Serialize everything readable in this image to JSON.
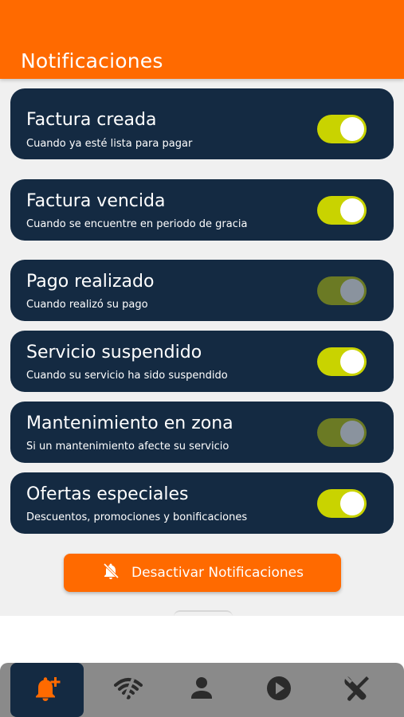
{
  "header": {
    "title": "Notificaciones"
  },
  "notifications": [
    {
      "title": "Factura creada",
      "subtitle": "Cuando ya esté lista para pagar",
      "enabled": true
    },
    {
      "title": "Factura vencida",
      "subtitle": "Cuando se encuentre en periodo de gracia",
      "enabled": true
    },
    {
      "title": "Pago realizado",
      "subtitle": "Cuando realizó su pago",
      "enabled": false
    },
    {
      "title": "Servicio suspendido",
      "subtitle": "Cuando su servicio ha sido suspendido",
      "enabled": true
    },
    {
      "title": "Mantenimiento en zona",
      "subtitle": "Si un mantenimiento afecte su servicio",
      "enabled": false
    },
    {
      "title": "Ofertas especiales",
      "subtitle": "Descuentos, promociones y bonificaciones",
      "enabled": true
    }
  ],
  "deactivate_button": {
    "label": "Desactivar Notificaciones",
    "icon": "bell-off-icon"
  },
  "bottom_nav": [
    {
      "icon": "bell-plus-icon",
      "active": true
    },
    {
      "icon": "wifi-off-icon",
      "active": false
    },
    {
      "icon": "user-icon",
      "active": false
    },
    {
      "icon": "play-circle-icon",
      "active": false
    },
    {
      "icon": "tools-icon",
      "active": false
    }
  ],
  "colors": {
    "brand_orange": "#ff6a00",
    "card_navy": "#142a42",
    "toggle_on": "#c9d300",
    "toggle_off": "#6b7a24",
    "nav_gray": "#8a8a8a"
  }
}
